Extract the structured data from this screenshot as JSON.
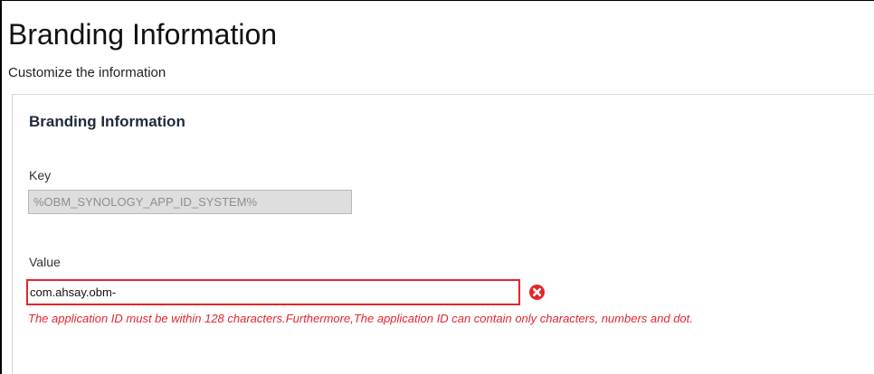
{
  "page": {
    "title": "Branding Information",
    "subtitle": "Customize the information"
  },
  "panel": {
    "title": "Branding Information",
    "key": {
      "label": "Key",
      "value": "%OBM_SYNOLOGY_APP_ID_SYSTEM%"
    },
    "value": {
      "label": "Value",
      "value": "com.ahsay.obm-",
      "error_icon": "error-circle-x-icon",
      "error_message": "The application ID must be within 128 characters.Furthermore,The application ID can contain only characters, numbers and dot."
    }
  },
  "colors": {
    "error": "#e3262c",
    "disabled_input_bg": "#dedede",
    "panel_border": "#d6d6d6"
  }
}
